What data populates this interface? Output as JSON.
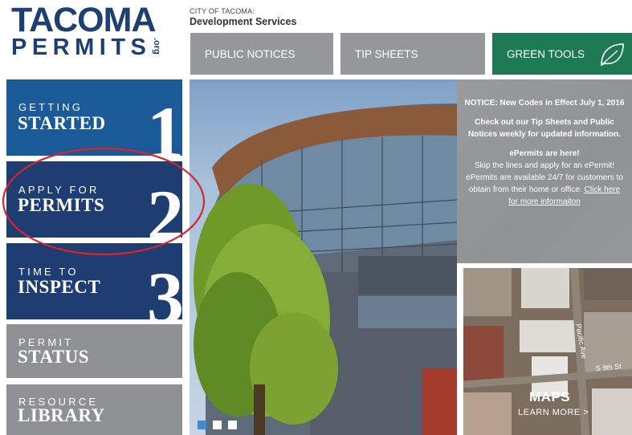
{
  "logo": {
    "line1": "TACOMA",
    "line2": "PERMITS",
    "suffix": ".org"
  },
  "header": {
    "small": "CITY OF TACOMA:",
    "title": "Development Services"
  },
  "nav": [
    {
      "label": "PUBLIC NOTICES"
    },
    {
      "label": "TIP SHEETS"
    },
    {
      "label": "GREEN TOOLS",
      "icon": "leaf-icon"
    }
  ],
  "tiles": [
    {
      "small": "GETTING",
      "big": "STARTED",
      "num": "1"
    },
    {
      "small": "APPLY FOR",
      "big": "PERMITS",
      "num": "2"
    },
    {
      "small": "TIME TO",
      "big": "INSPECT",
      "num": "3"
    },
    {
      "small": "PERMIT",
      "big": "STATUS"
    },
    {
      "small": "RESOURCE",
      "big": "LIBRARY"
    }
  ],
  "notice": {
    "headline": "NOTICE: New Codes in Effect July 1, 2016",
    "tip": "Check out our Tip Sheets and Public Notices weekly for updated information.",
    "epermits_title": "ePermits are here!",
    "epermits_body": "Skip the lines and apply for an ePermit! ePermits are available 24/7 for customers to obtain from their home or office.",
    "link": "Click here for more informaiton"
  },
  "maps": {
    "title": "MAPS",
    "sub": "LEARN MORE >",
    "street1": "Pacific Ave",
    "street2": "S 9th St"
  },
  "slider": {
    "count": 3,
    "active": 1
  },
  "colors": {
    "navy": "#1e3d72",
    "blue": "#1a5a99",
    "gray": "#8e9093",
    "green": "#1d7a55",
    "annotation": "#d8242a"
  }
}
